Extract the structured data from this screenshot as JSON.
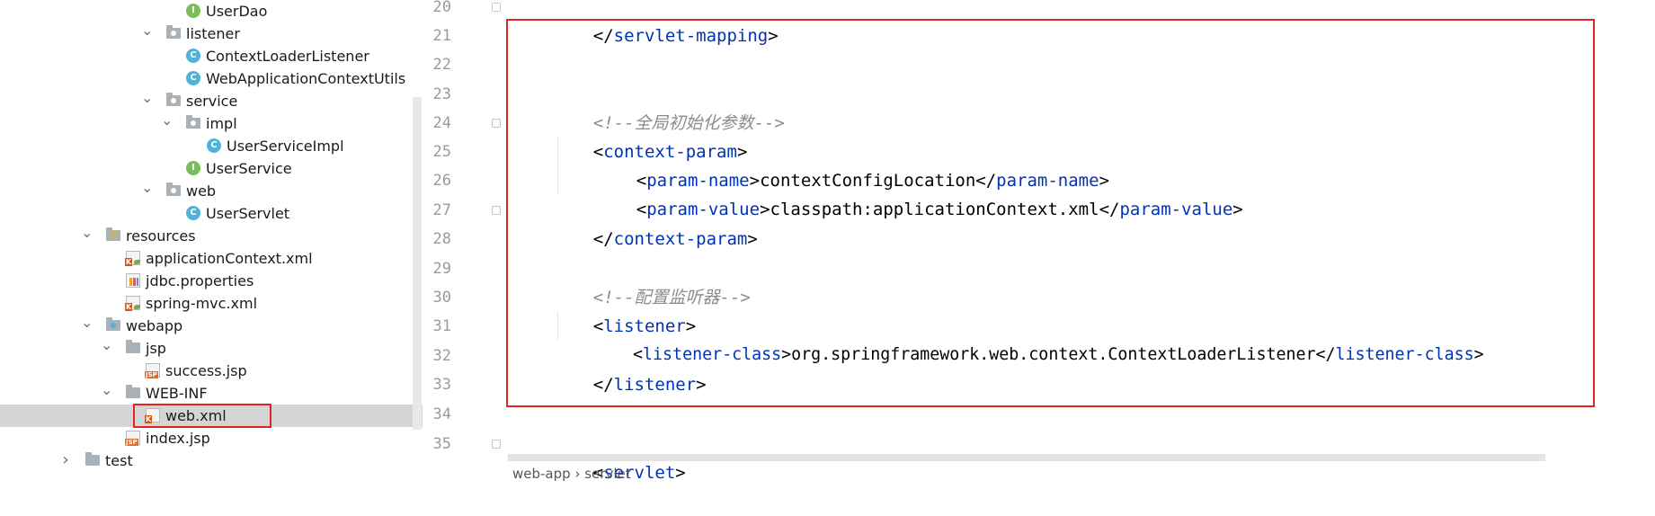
{
  "tree": {
    "items": [
      {
        "label": "UserDao",
        "icon": "interface-icon"
      },
      {
        "label": "listener",
        "icon": "package-icon"
      },
      {
        "label": "ContextLoaderListener",
        "icon": "class-icon"
      },
      {
        "label": "WebApplicationContextUtils",
        "icon": "class-icon"
      },
      {
        "label": "service",
        "icon": "package-icon"
      },
      {
        "label": "impl",
        "icon": "package-icon"
      },
      {
        "label": "UserServiceImpl",
        "icon": "class-icon"
      },
      {
        "label": "UserService",
        "icon": "interface-icon"
      },
      {
        "label": "web",
        "icon": "package-icon"
      },
      {
        "label": "UserServlet",
        "icon": "class-icon"
      },
      {
        "label": "resources",
        "icon": "resources-folder-icon"
      },
      {
        "label": "applicationContext.xml",
        "icon": "spring-xml-icon"
      },
      {
        "label": "jdbc.properties",
        "icon": "properties-file-icon"
      },
      {
        "label": "spring-mvc.xml",
        "icon": "spring-xml-icon"
      },
      {
        "label": "webapp",
        "icon": "web-folder-icon"
      },
      {
        "label": "jsp",
        "icon": "folder-icon"
      },
      {
        "label": "success.jsp",
        "icon": "jsp-file-icon"
      },
      {
        "label": "WEB-INF",
        "icon": "folder-icon"
      },
      {
        "label": "web.xml",
        "icon": "xml-file-icon"
      },
      {
        "label": "index.jsp",
        "icon": "jsp-file-icon"
      },
      {
        "label": "test",
        "icon": "folder-icon"
      }
    ],
    "selected": "web.xml",
    "icon_letters": {
      "interface": "I",
      "class": "C",
      "jsp": "JSP",
      "xml": "K"
    }
  },
  "editor": {
    "line_numbers": [
      "20",
      "21",
      "22",
      "23",
      "24",
      "25",
      "26",
      "27",
      "28",
      "29",
      "30",
      "31",
      "32",
      "33",
      "34",
      "35"
    ],
    "lines": {
      "l20": {
        "open": "</",
        "tag": "servlet-mapping",
        "close": ">"
      },
      "l23": {
        "comment": "<!--全局初始化参数-->"
      },
      "l24": {
        "open": "<",
        "tag": "context-param",
        "close": ">"
      },
      "l25": {
        "open": "<",
        "tag": "param-name",
        "close": ">",
        "text": "contextConfigLocation",
        "open2": "</",
        "tag2": "param-name",
        "close2": ">"
      },
      "l26": {
        "open": "<",
        "tag": "param-value",
        "close": ">",
        "text": "classpath:applicationContext.xml",
        "open2": "</",
        "tag2": "param-value",
        "close2": ">"
      },
      "l27": {
        "open": "</",
        "tag": "context-param",
        "close": ">"
      },
      "l29": {
        "comment": "<!--配置监听器-->"
      },
      "l30": {
        "open": "<",
        "tag": "listener",
        "close": ">"
      },
      "l31": {
        "open": "<",
        "tag": "listener-class",
        "close": ">",
        "text": "org.springframework.web.context.ContextLoaderListener",
        "open2": "</",
        "tag2": "listener-class",
        "close2": ">"
      },
      "l32": {
        "open": "</",
        "tag": "listener",
        "close": ">"
      },
      "l35": {
        "open": "<",
        "tag": "servlet",
        "close": ">"
      }
    },
    "breadcrumb": [
      "web-app",
      "servlet"
    ],
    "breadcrumb_sep": "›"
  },
  "colors": {
    "tag": "#0033b3",
    "comment": "#8c8c8c",
    "highlight": "#e02424",
    "selection": "#d5d5d5"
  }
}
